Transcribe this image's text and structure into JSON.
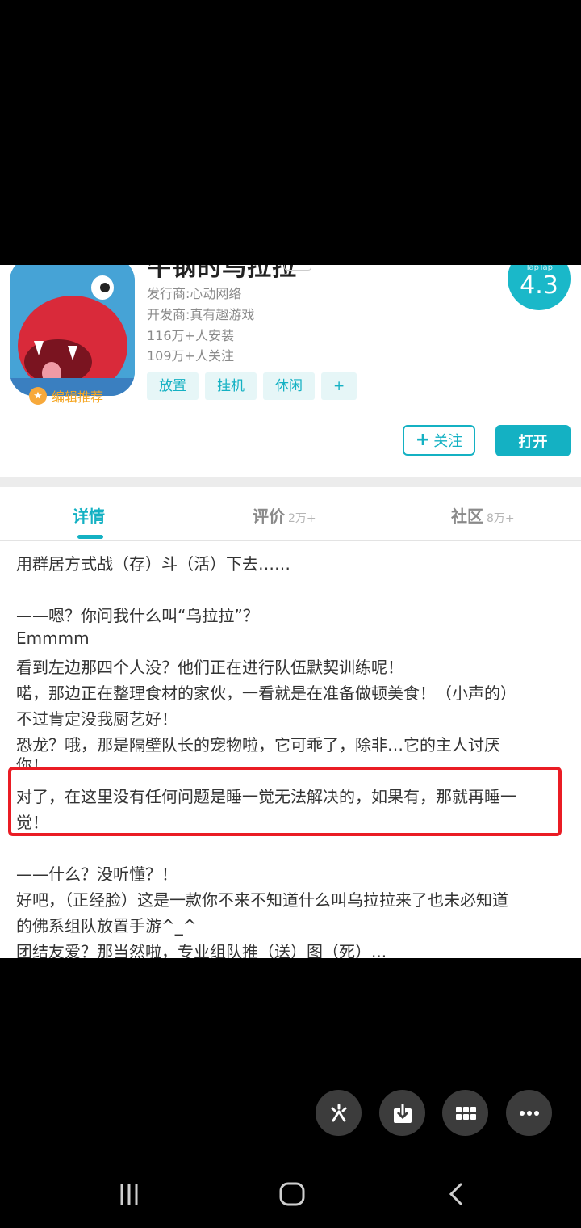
{
  "app": {
    "title_peek": "牛钢的乌拉拉",
    "publisher": "发行商:心动网络",
    "developer": "开发商:真有趣游戏",
    "installs": "116万+人安装",
    "follows": "109万+人关注",
    "editor_pick": "编辑推荐",
    "tags": [
      "放置",
      "挂机",
      "休闲",
      "+"
    ],
    "score_source": "TapTap",
    "score": "4.3",
    "follow_label": "关注",
    "open_label": "打开"
  },
  "tabs": [
    {
      "label": "详情",
      "count": ""
    },
    {
      "label": "评价",
      "count": "2万+"
    },
    {
      "label": "社区",
      "count": "8万+"
    }
  ],
  "description": [
    "用群居方式战（存）斗（活）下去……",
    "",
    "——嗯？你问我什么叫“乌拉拉”？",
    "Emmmm",
    "看到左边那四个人没？他们正在进行队伍默契训练呢！",
    "喏，那边正在整理食材的家伙，一看就是在准备做顿美食！（小声的）",
    "不过肯定没我厨艺好！",
    "恐龙？哦，那是隔壁队长的宠物啦，它可乖了，除非…它的主人讨厌",
    "你！",
    "对了，在这里没有任何问题是睡一觉无法解决的，如果有，那就再睡一",
    "觉！",
    "",
    "——什么？没听懂？！",
    "好吧，（正经脸）这是一款你不来不知道什么叫乌拉拉来了也未必知道",
    "的佛系组队放置手游^_^",
    "团结友爱？那当然啦，专业组队推（送）图（死）..."
  ],
  "colors": {
    "accent": "#14b1c3",
    "highlight": "#ea1c24",
    "editor_pick": "#f5a623"
  },
  "overlay_icons": [
    "tools-icon",
    "download-icon",
    "grid-icon",
    "more-icon"
  ],
  "navbar_icons": [
    "recents-icon",
    "home-icon",
    "back-icon"
  ]
}
